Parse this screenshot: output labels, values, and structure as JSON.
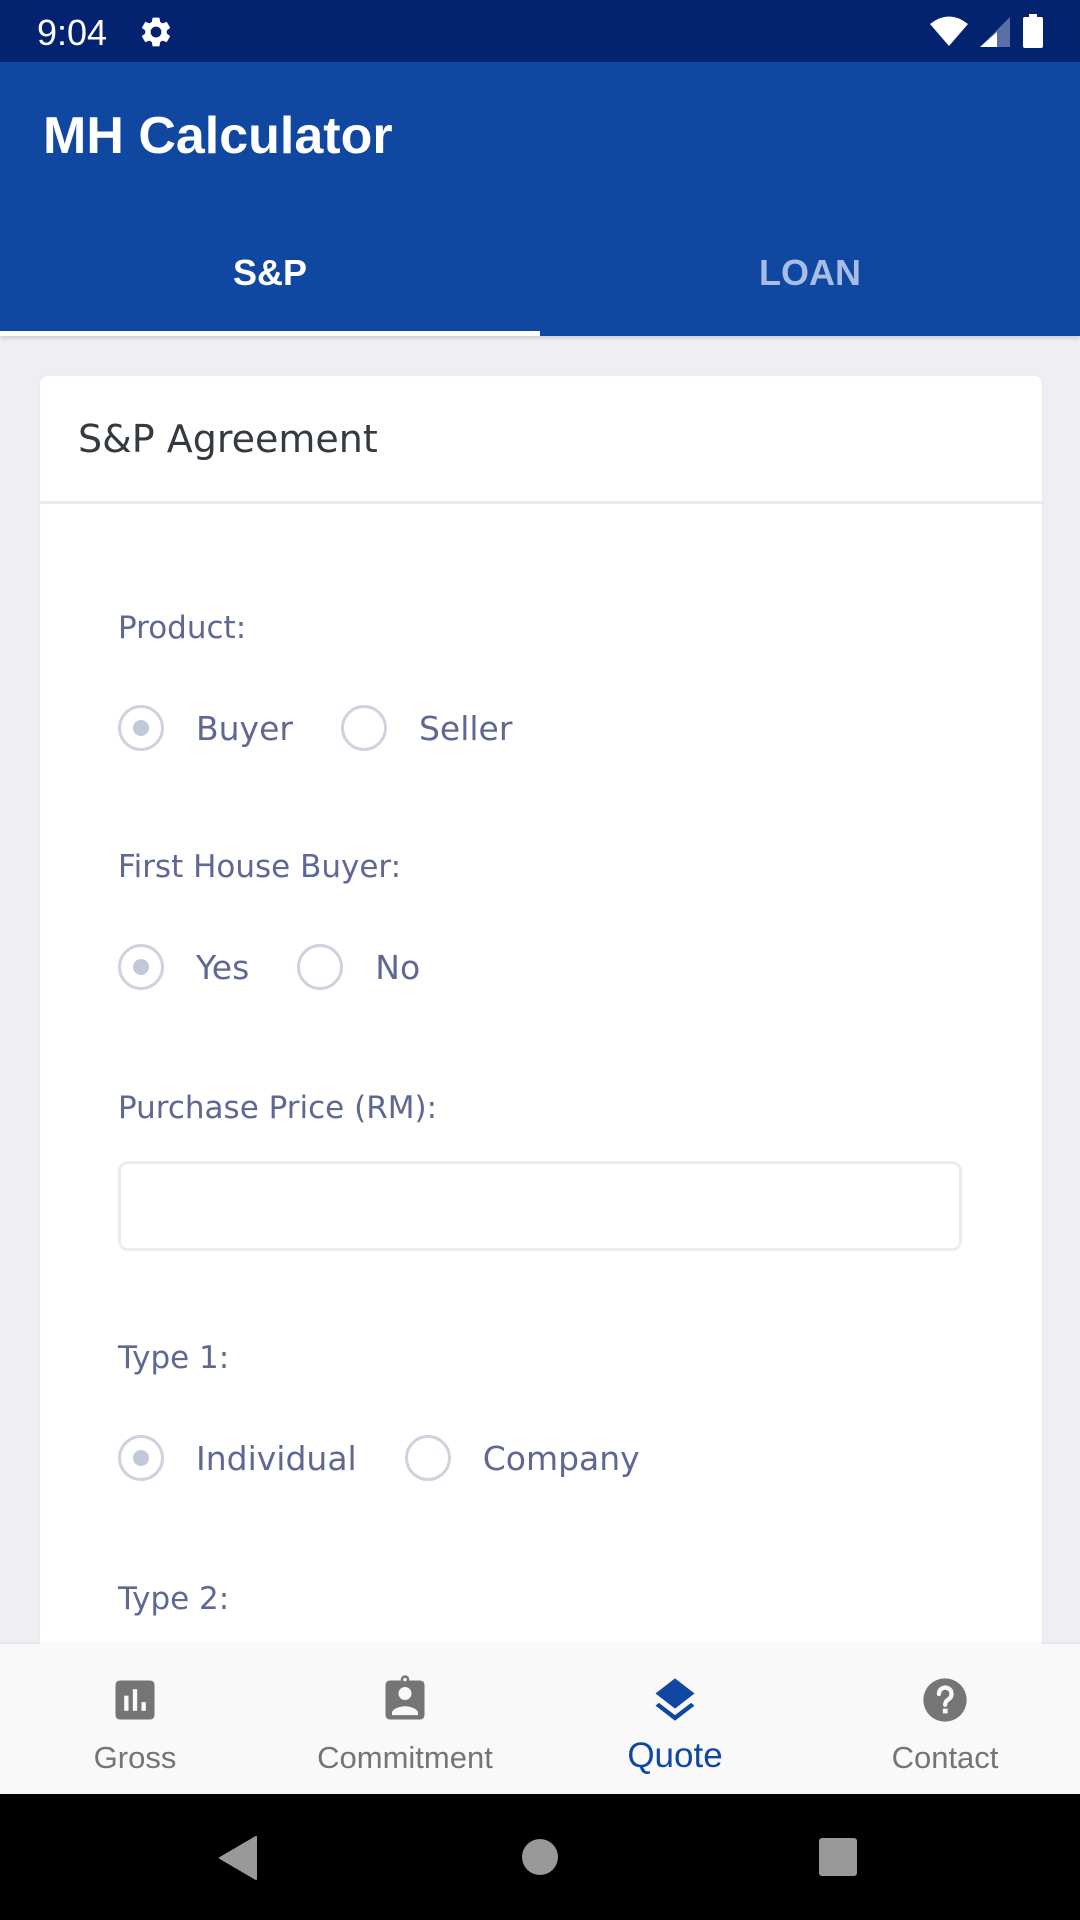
{
  "status_bar": {
    "time": "9:04",
    "icons": [
      "gear-icon",
      "wifi-icon",
      "signal-icon",
      "battery-icon"
    ]
  },
  "app": {
    "title": "MH Calculator",
    "primary_color": "#0f47a1",
    "status_bar_color": "#03226f"
  },
  "tabs": [
    {
      "label": "S&P",
      "active": true
    },
    {
      "label": "LOAN",
      "active": false
    }
  ],
  "card": {
    "title": "S&P Agreement",
    "fields": {
      "product": {
        "label": "Product:",
        "options": [
          {
            "label": "Buyer",
            "selected": true
          },
          {
            "label": "Seller",
            "selected": false
          }
        ]
      },
      "first_house_buyer": {
        "label": "First House Buyer:",
        "options": [
          {
            "label": "Yes",
            "selected": true
          },
          {
            "label": "No",
            "selected": false
          }
        ]
      },
      "purchase_price": {
        "label": "Purchase Price (RM):",
        "value": "",
        "placeholder": ""
      },
      "type1": {
        "label": "Type 1:",
        "options": [
          {
            "label": "Individual",
            "selected": true
          },
          {
            "label": "Company",
            "selected": false
          }
        ]
      },
      "type2": {
        "label": "Type 2:"
      }
    }
  },
  "bottom_nav": [
    {
      "label": "Gross",
      "icon": "bar-chart-icon",
      "active": false
    },
    {
      "label": "Commitment",
      "icon": "clipboard-account-icon",
      "active": false
    },
    {
      "label": "Quote",
      "icon": "layers-icon",
      "active": true
    },
    {
      "label": "Contact",
      "icon": "help-circle-icon",
      "active": false
    }
  ],
  "system_nav": [
    "back-icon",
    "home-icon",
    "recents-icon"
  ]
}
